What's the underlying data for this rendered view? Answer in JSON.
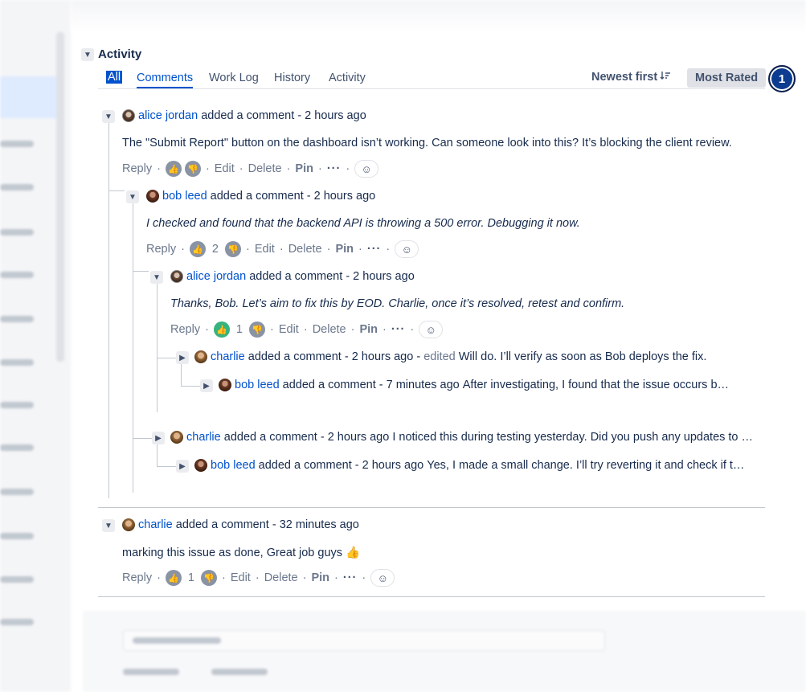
{
  "section": {
    "title": "Activity"
  },
  "tabs": [
    {
      "label": "All"
    },
    {
      "label": "Comments"
    },
    {
      "label": "Work Log"
    },
    {
      "label": "History"
    },
    {
      "label": "Activity"
    }
  ],
  "sort": {
    "label": "Newest first",
    "icon": "sort-icon"
  },
  "filter": {
    "label": "Most Rated"
  },
  "badge": {
    "value": "1"
  },
  "comments": {
    "c1": {
      "author": "alice jordan",
      "action": "added a comment",
      "time": "- 2 hours ago",
      "body": "The \"Submit Report\" button on the dashboard isn’t working. Can someone look into this? It’s blocking the client review.",
      "reply": "Reply",
      "edit": "Edit",
      "delete": "Delete",
      "pin": "Pin",
      "likes": ""
    },
    "c2": {
      "author": "bob leed",
      "action": "added a comment",
      "time": "- 2 hours ago",
      "body": "I checked and found that the backend API is throwing a 500 error. Debugging it now.",
      "reply": "Reply",
      "edit": "Edit",
      "delete": "Delete",
      "pin": "Pin",
      "likes": "2"
    },
    "c3": {
      "author": "alice jordan",
      "action": "added a comment",
      "time": "- 2 hours ago",
      "body": "Thanks, Bob. Let’s aim to fix this by EOD. Charlie, once it’s resolved, retest and confirm.",
      "reply": "Reply",
      "edit": "Edit",
      "delete": "Delete",
      "pin": "Pin",
      "likes": "1"
    },
    "c4": {
      "author": "charlie",
      "action": "added a comment",
      "time": "- 2 hours ago -",
      "edited": "edited",
      "preview": "Will do. I’ll verify as soon as Bob deploys the fix."
    },
    "c5": {
      "author": "bob leed",
      "action": "added a comment",
      "time": "- 7 minutes ago",
      "preview": "After investigating, I found that the issue occurs b…"
    },
    "c6": {
      "author": "charlie",
      "action": "added a comment",
      "time": "- 2 hours ago",
      "preview": "I noticed this during testing yesterday. Did you push any updates to …"
    },
    "c7": {
      "author": "bob leed",
      "action": "added a comment",
      "time": "- 2 hours ago",
      "preview": "Yes, I made a small change. I’ll try reverting it and check if t…"
    },
    "c8": {
      "author": "charlie",
      "action": "added a comment",
      "time": "- 32 minutes ago",
      "body": "marking this issue as done, Great job guys 👍",
      "reply": "Reply",
      "edit": "Edit",
      "delete": "Delete",
      "pin": "Pin",
      "likes": "1"
    }
  },
  "colors": {
    "accent": "#0052cc",
    "like_active": "#36b37e",
    "badge": "#0c3c8f"
  }
}
